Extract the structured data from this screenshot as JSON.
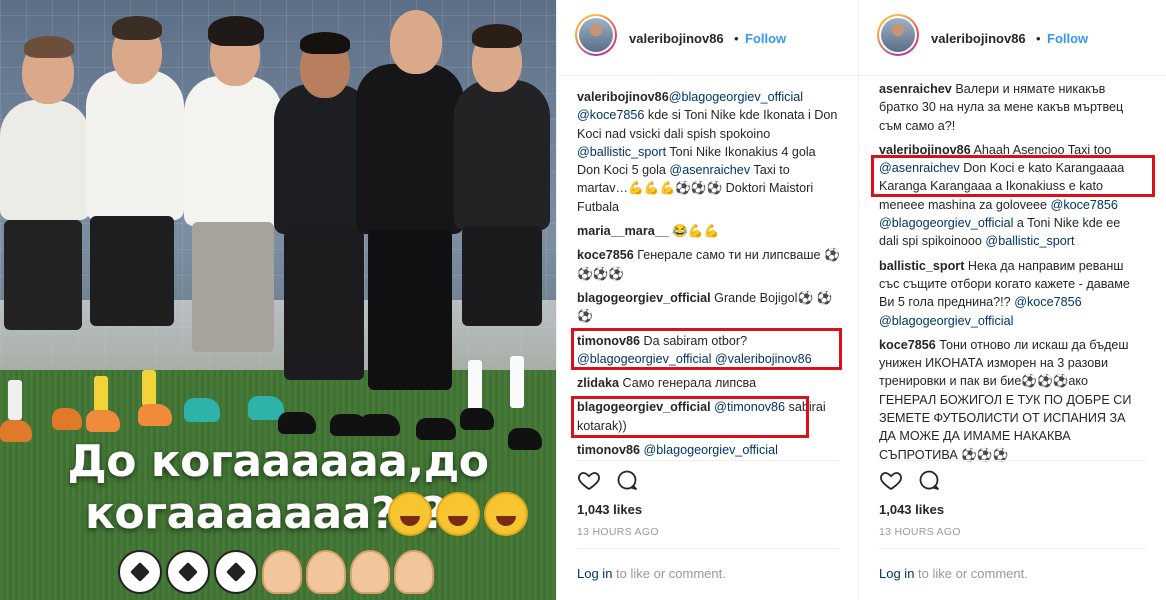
{
  "photo": {
    "caption_line1": "До когаааааа,до",
    "caption_line2": "когааааааа????"
  },
  "post_a": {
    "username": "valeribojinov86",
    "follow_label": "Follow",
    "likes": "1,043 likes",
    "time": "13 HOURS AGO",
    "login_link": "Log in",
    "login_rest": " to like or comment.",
    "comments": [
      {
        "user": "valeribojinov86",
        "parts": [
          {
            "t": "@blagogeorgiev_official",
            "m": true
          },
          {
            "t": " ",
            "m": false
          },
          {
            "t": "@koce7856",
            "m": true
          },
          {
            "t": " kde si Toni Nike kde Ikonata i Don Koci nad vsicki dali spish spokoino ",
            "m": false
          },
          {
            "t": "@ballistic_sport",
            "m": true
          },
          {
            "t": " Toni Nike Ikonakius 4 gola Don Koci 5 gola ",
            "m": false
          },
          {
            "t": "@asenraichev",
            "m": true
          },
          {
            "t": " Taxi to martav…💪💪💪⚽⚽⚽ Doktori Maistori Futbala",
            "m": false
          }
        ]
      },
      {
        "user": "maria__mara__",
        "parts": [
          {
            "t": " 😂💪💪",
            "m": false
          }
        ]
      },
      {
        "user": "koce7856",
        "parts": [
          {
            "t": " Генерале само ти ни липсваше ⚽⚽⚽⚽",
            "m": false
          }
        ]
      },
      {
        "user": "blagogeorgiev_official",
        "parts": [
          {
            "t": " Grande Bojigol⚽ ⚽⚽",
            "m": false
          }
        ]
      },
      {
        "user": "timonov86",
        "parts": [
          {
            "t": " Da sabiram otbor? ",
            "m": false
          },
          {
            "t": "@blagogeorgiev_official",
            "m": true
          },
          {
            "t": " ",
            "m": false
          },
          {
            "t": "@valeribojinov86",
            "m": true
          }
        ]
      },
      {
        "user": "zlidaka",
        "parts": [
          {
            "t": " Само генерала липсва",
            "m": false
          }
        ]
      },
      {
        "user": "blagogeorgiev_official",
        "parts": [
          {
            "t": " ",
            "m": false
          },
          {
            "t": "@timonov86",
            "m": true
          },
          {
            "t": " sabirai kotarak))",
            "m": false
          }
        ]
      },
      {
        "user": "timonov86",
        "parts": [
          {
            "t": " ",
            "m": false
          },
          {
            "t": "@blagogeorgiev_official",
            "m": true
          }
        ]
      }
    ]
  },
  "post_b": {
    "username": "valeribojinov86",
    "follow_label": "Follow",
    "likes": "1,043 likes",
    "time": "13 HOURS AGO",
    "login_link": "Log in",
    "login_rest": " to like or comment.",
    "comments": [
      {
        "user": "asenraichev",
        "parts": [
          {
            "t": " Валери и нямате никакъв братко 30 на нула за мене какъв мъртвец съм само а?!",
            "m": false
          }
        ]
      },
      {
        "user": "valeribojinov86",
        "parts": [
          {
            "t": " Ahaah Asencioo Taxi too ",
            "m": false
          },
          {
            "t": "@asenraichev",
            "m": true
          },
          {
            "t": " Don Koci e kato Karangaaaa Karanga Karangaaa a Ikonakiuss e kato meneee mashina za goloveee ",
            "m": false
          },
          {
            "t": "@koce7856",
            "m": true
          },
          {
            "t": " ",
            "m": false
          },
          {
            "t": "@blagogeorgiev_official",
            "m": true
          },
          {
            "t": " a Toni Nike kde ee dali spi spikoinooo ",
            "m": false
          },
          {
            "t": "@ballistic_sport",
            "m": true
          }
        ]
      },
      {
        "user": "ballistic_sport",
        "parts": [
          {
            "t": " Нека да направим реванш със същите отбори когато кажете - даваме Ви 5 гола преднина?!? ",
            "m": false
          },
          {
            "t": "@koce7856",
            "m": true
          },
          {
            "t": " ",
            "m": false
          },
          {
            "t": "@blagogeorgiev_official",
            "m": true
          }
        ]
      },
      {
        "user": "koce7856",
        "parts": [
          {
            "t": " Тони отново ли искаш да бъдеш унижен ИКОНАТА изморен на 3 разови тренировки и пак ви бие⚽⚽⚽ако ГЕНЕРАЛ БОЖИГОЛ Е ТУК ПО ДОБРЕ СИ ЗЕМЕТЕ ФУТБОЛИСТИ ОТ ИСПАНИЯ ЗА ДА МОЖЕ ДА ИМАМЕ НАКАКВА СЪПРОТИВА ⚽⚽⚽",
            "m": false
          }
        ]
      }
    ]
  },
  "colors": {
    "follow": "#3897f0",
    "mention": "#003569",
    "highlight_box": "#d8111a",
    "muted": "#999999"
  }
}
